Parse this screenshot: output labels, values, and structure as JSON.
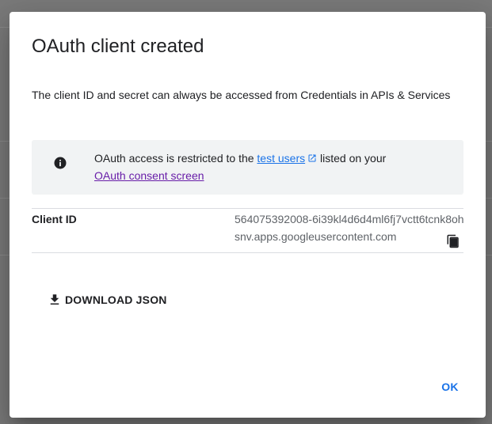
{
  "dialog": {
    "title": "OAuth client created",
    "description": "The client ID and secret can always be accessed from Credentials in APIs & Services"
  },
  "info": {
    "icon": "info-icon",
    "text_prefix": "OAuth access is restricted to the ",
    "test_users_link": "test users",
    "external_link_icon": "external-link-icon",
    "text_middle": " listed on your",
    "consent_link": "OAuth consent screen"
  },
  "client": {
    "label": "Client ID",
    "value": "564075392008-6i39kl4d6d4ml6fj7vctt6tcnk8ohsnv.apps.googleusercontent.com",
    "copy_icon": "copy-icon"
  },
  "actions": {
    "download_label": "DOWNLOAD JSON",
    "download_icon": "download-icon",
    "ok_label": "OK"
  },
  "colors": {
    "primary": "#1a73e8",
    "visited_link": "#681da8",
    "text": "#202124",
    "secondary_text": "#5f6368",
    "info_background": "#f1f3f4",
    "divider": "#dadce0"
  }
}
